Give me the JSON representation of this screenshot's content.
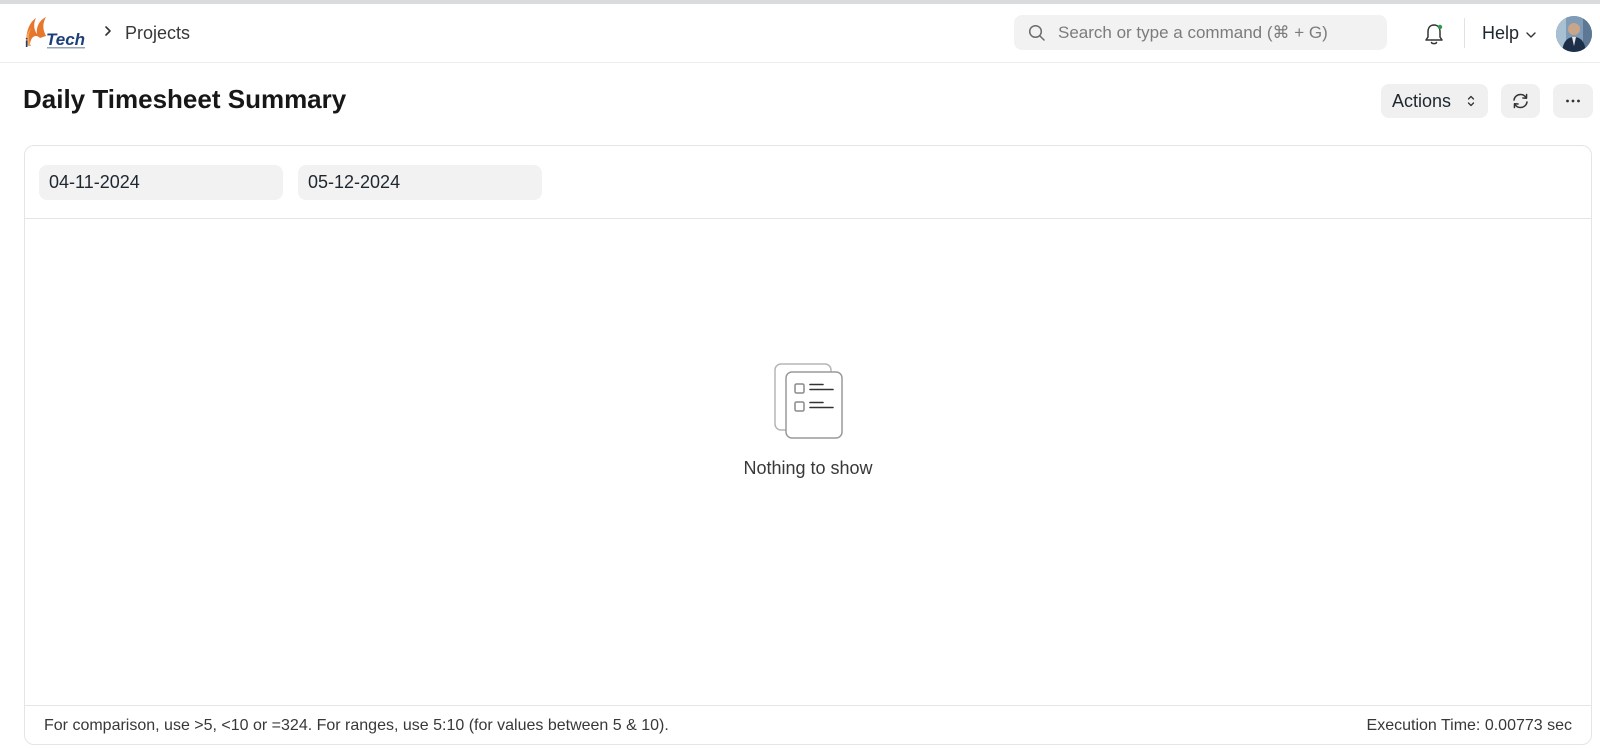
{
  "navbar": {
    "logo_text": "Tech",
    "breadcrumb": "Projects",
    "search_placeholder": "Search or type a command (⌘ + G)",
    "help_label": "Help"
  },
  "page": {
    "title": "Daily Timesheet Summary",
    "actions_label": "Actions"
  },
  "filters": {
    "from_date": "04-11-2024",
    "to_date": "05-12-2024"
  },
  "empty_state": {
    "message": "Nothing to show"
  },
  "footer": {
    "hint": "For comparison, use >5, <10 or =324. For ranges, use 5:10 (for values between 5 & 10).",
    "execution_time": "Execution Time: 0.00773 sec"
  },
  "colors": {
    "accent_logo": "#e8772e",
    "logo_text": "#1d3f7a"
  }
}
